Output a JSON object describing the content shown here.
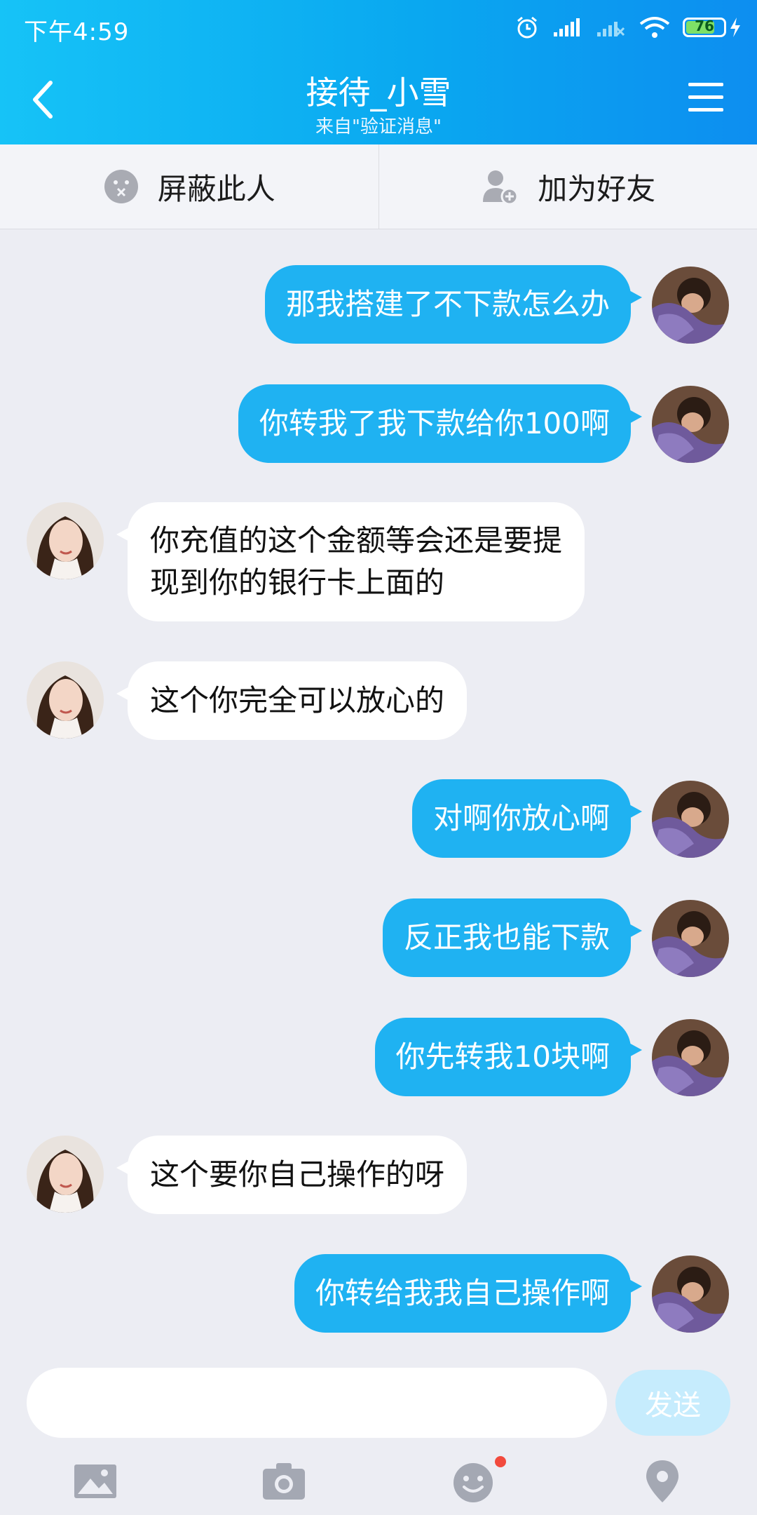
{
  "status": {
    "time": "下午4:59",
    "battery": "76"
  },
  "header": {
    "title": "接待_小雪",
    "subtitle": "来自\"验证消息\""
  },
  "actions": {
    "block_label": "屏蔽此人",
    "add_friend_label": "加为好友"
  },
  "messages": [
    {
      "from": "me",
      "text": "那我搭建了不下款怎么办"
    },
    {
      "from": "me",
      "text": "你转我了我下款给你100啊"
    },
    {
      "from": "her",
      "line1": "你充值的这个金额等会还是要提",
      "line2": "现到你的银行卡上面的"
    },
    {
      "from": "her",
      "text": "这个你完全可以放心的"
    },
    {
      "from": "me",
      "text": "对啊你放心啊"
    },
    {
      "from": "me",
      "text": "反正我也能下款"
    },
    {
      "from": "me",
      "text": "你先转我10块啊"
    },
    {
      "from": "her",
      "text": "这个要你自己操作的呀"
    },
    {
      "from": "me",
      "text": "你转给我我自己操作啊"
    }
  ],
  "composer": {
    "input_value": "",
    "send_label": "发送"
  },
  "toolbar": {
    "icons": [
      "image-icon",
      "camera-icon",
      "emoji-icon",
      "location-icon"
    ]
  },
  "colors": {
    "header_start": "#16c3f7",
    "header_end": "#0d8ef0",
    "my_bubble": "#1fb2f2",
    "her_bubble": "#ffffff",
    "background": "#ecedf3",
    "notification_dot": "#f24a3d"
  }
}
